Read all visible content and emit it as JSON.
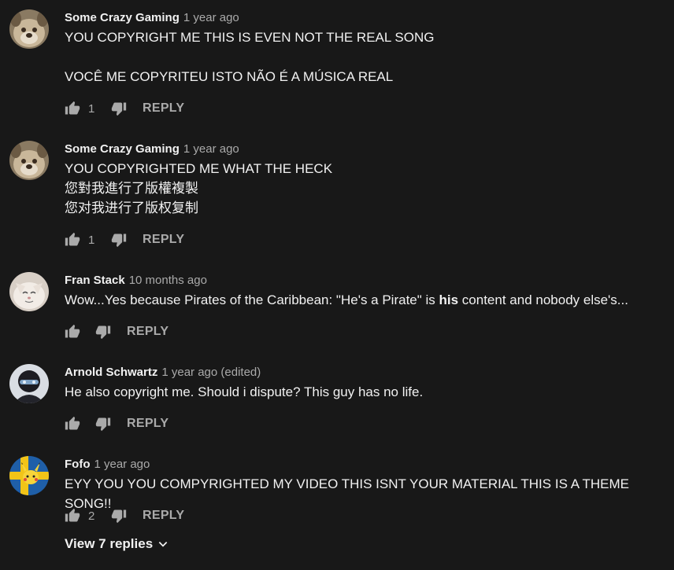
{
  "comments": [
    {
      "author": "Some Crazy Gaming",
      "meta": "1 year ago",
      "lines": [
        "YOU COPYRIGHT ME THIS IS EVEN NOT THE REAL SONG",
        "",
        "VOCÊ ME COPYRITEU ISTO NÃO É A MÚSICA REAL"
      ],
      "likes": "1",
      "reply_label": "REPLY",
      "avatar": "dog-avatar"
    },
    {
      "author": "Some Crazy Gaming",
      "meta": "1 year ago",
      "lines": [
        "YOU COPYRIGHTED ME WHAT THE HECK",
        "您對我進行了版權複製",
        "您对我进行了版权复制"
      ],
      "likes": "1",
      "reply_label": "REPLY",
      "avatar": "dog-avatar"
    },
    {
      "author": "Fran Stack",
      "meta": "10 months ago",
      "text_before": "Wow...Yes because Pirates of the Caribbean: \"He's a Pirate\" is ",
      "text_bold": "his",
      "text_after": " content and nobody else's...",
      "likes": "",
      "reply_label": "REPLY",
      "avatar": "cat-avatar"
    },
    {
      "author": "Arnold Schwartz",
      "meta": "1 year ago (edited)",
      "lines": [
        "He also copyright me. Should i dispute? This guy has no life."
      ],
      "likes": "",
      "reply_label": "REPLY",
      "avatar": "masked-person-avatar"
    },
    {
      "author": "Fofo",
      "meta": "1 year ago",
      "lines": [
        "EYY YOU YOU COMPYRIGHTED MY VIDEO THIS ISNT YOUR MATERIAL THIS IS A THEME SONG!!"
      ],
      "likes": "2",
      "reply_label": "REPLY",
      "avatar": "pikachu-flag-avatar"
    }
  ],
  "view_replies": "View 7 replies",
  "colors": {
    "background": "#181818",
    "text": "#f1f1f1",
    "secondary": "#aaaaaa"
  }
}
